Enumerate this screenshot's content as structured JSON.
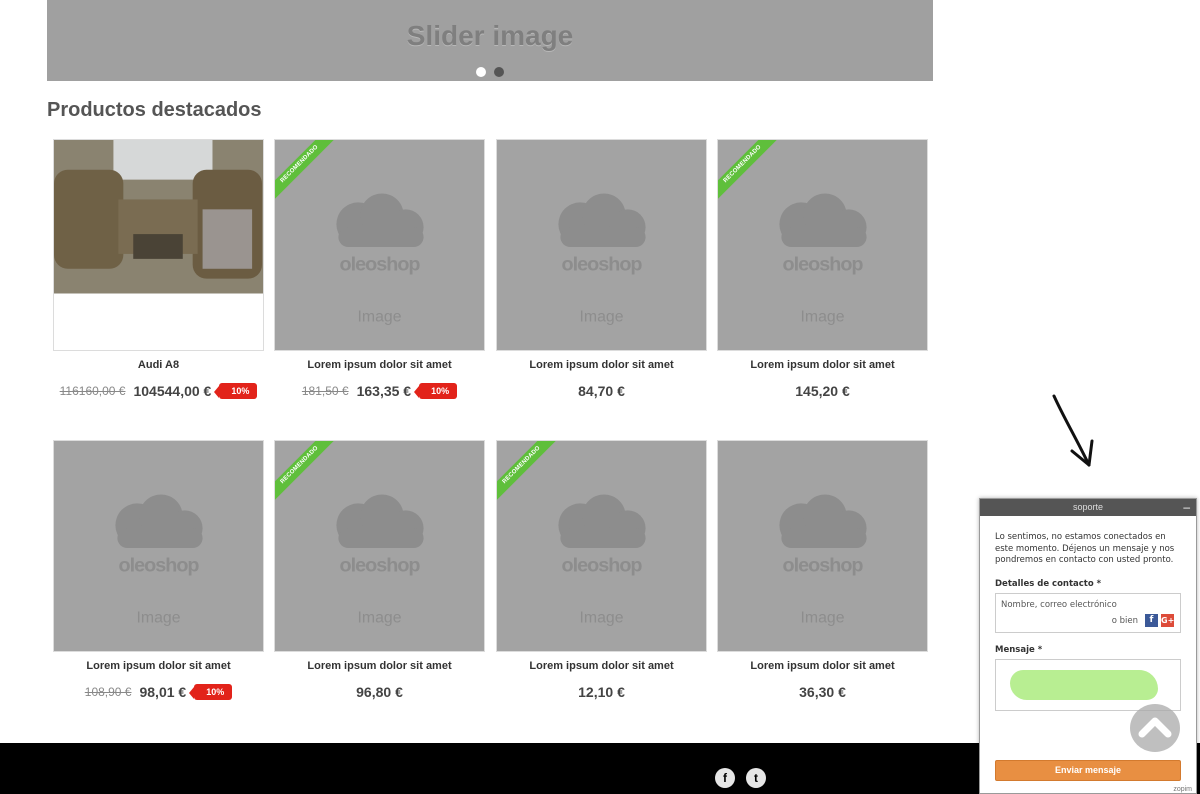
{
  "slider": {
    "text": "Slider image",
    "dots": 2,
    "active_dot": 0
  },
  "section": {
    "title": "Productos destacados"
  },
  "placeholder": {
    "brand": "oleoshop",
    "caption": "Image"
  },
  "ribbon_text": "RECOMENDADO",
  "products": [
    {
      "name": "Audi A8",
      "old_price": "116160,00 €",
      "price": "104544,00 €",
      "discount": "10%",
      "recommended": false,
      "photo": true
    },
    {
      "name": "Lorem ipsum dolor sit amet",
      "old_price": "181,50 €",
      "price": "163,35 €",
      "discount": "10%",
      "recommended": true,
      "photo": false
    },
    {
      "name": "Lorem ipsum dolor sit amet",
      "old_price": "",
      "price": "84,70 €",
      "discount": "",
      "recommended": false,
      "photo": false
    },
    {
      "name": "Lorem ipsum dolor sit amet",
      "old_price": "",
      "price": "145,20 €",
      "discount": "",
      "recommended": true,
      "photo": false
    },
    {
      "name": "Lorem ipsum dolor sit amet",
      "old_price": "108,90 €",
      "price": "98,01 €",
      "discount": "10%",
      "recommended": false,
      "photo": false
    },
    {
      "name": "Lorem ipsum dolor sit amet",
      "old_price": "",
      "price": "96,80 €",
      "discount": "",
      "recommended": true,
      "photo": false
    },
    {
      "name": "Lorem ipsum dolor sit amet",
      "old_price": "",
      "price": "12,10 €",
      "discount": "",
      "recommended": true,
      "photo": false
    },
    {
      "name": "Lorem ipsum dolor sit amet",
      "old_price": "",
      "price": "36,30 €",
      "discount": "",
      "recommended": false,
      "photo": false
    }
  ],
  "footer": {
    "facebook_glyph": "f",
    "twitter_glyph": "t"
  },
  "chat": {
    "title": "soporte",
    "minimize": "–",
    "message": "Lo sentimos, no estamos conectados en este momento. Déjenos un mensaje y nos pondremos en contacto con usted pronto.",
    "contact_label": "Detalles de contacto *",
    "contact_placeholder": "Nombre, correo electrónico",
    "or_text": "o bien",
    "fb_glyph": "f",
    "gplus_glyph": "G+",
    "message_label": "Mensaje *",
    "send_label": "Enviar mensaje",
    "branding": "zopim"
  },
  "colors": {
    "accent": "#e88f42",
    "discount": "#e2231a",
    "ribbon": "#5fbf3b"
  }
}
